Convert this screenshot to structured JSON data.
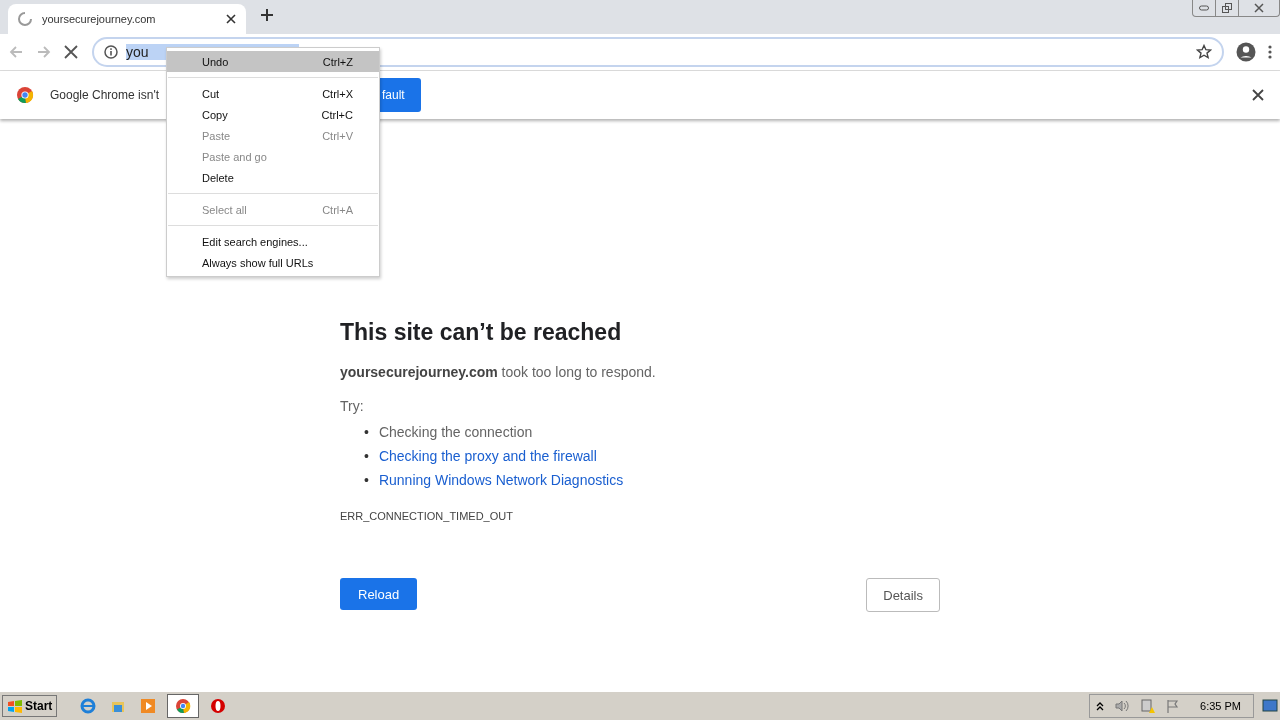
{
  "tab": {
    "title": "yoursecurejourney.com",
    "loading": true
  },
  "address_bar": {
    "value": "you",
    "selected": true
  },
  "infobar": {
    "message": "Google Chrome isn't",
    "button": "fault"
  },
  "context_menu": [
    {
      "kind": "item",
      "label": "Undo",
      "shortcut": "Ctrl+Z",
      "disabled": false,
      "selected": true
    },
    {
      "kind": "separator"
    },
    {
      "kind": "item",
      "label": "Cut",
      "shortcut": "Ctrl+X",
      "disabled": false,
      "selected": false
    },
    {
      "kind": "item",
      "label": "Copy",
      "shortcut": "Ctrl+C",
      "disabled": false,
      "selected": false
    },
    {
      "kind": "item",
      "label": "Paste",
      "shortcut": "Ctrl+V",
      "disabled": true,
      "selected": false
    },
    {
      "kind": "item",
      "label": "Paste and go",
      "disabled": true,
      "selected": false
    },
    {
      "kind": "item",
      "label": "Delete",
      "disabled": false,
      "selected": false
    },
    {
      "kind": "separator"
    },
    {
      "kind": "item",
      "label": "Select all",
      "shortcut": "Ctrl+A",
      "disabled": true,
      "selected": false
    },
    {
      "kind": "separator"
    },
    {
      "kind": "item",
      "label": "Edit search engines...",
      "disabled": false,
      "selected": false
    },
    {
      "kind": "item",
      "label": "Always show full URLs",
      "disabled": false,
      "selected": false
    }
  ],
  "error_page": {
    "title": "This site can’t be reached",
    "message": "**yoursecurejourney.com** took too long to respond.",
    "try_label": "Try:",
    "suggestions": [
      {
        "bullet": "•",
        "text": "Checking the connection",
        "link": false
      },
      {
        "bullet": "•",
        "text": "Checking the proxy and the firewall",
        "link": true
      },
      {
        "bullet": "•",
        "text": "Running Windows Network Diagnostics",
        "link": true
      }
    ],
    "error_code": "ERR_CONNECTION_TIMED_OUT",
    "reload_button": "Reload",
    "details_button": "Details"
  },
  "taskbar": {
    "start": "Start",
    "apps": [
      {
        "kind": "ie",
        "selected": false
      },
      {
        "kind": "explorer",
        "selected": false
      },
      {
        "kind": "media",
        "selected": false
      },
      {
        "kind": "chrome",
        "selected": true
      },
      {
        "kind": "opera",
        "selected": false
      }
    ],
    "clock": "6:35 PM"
  }
}
